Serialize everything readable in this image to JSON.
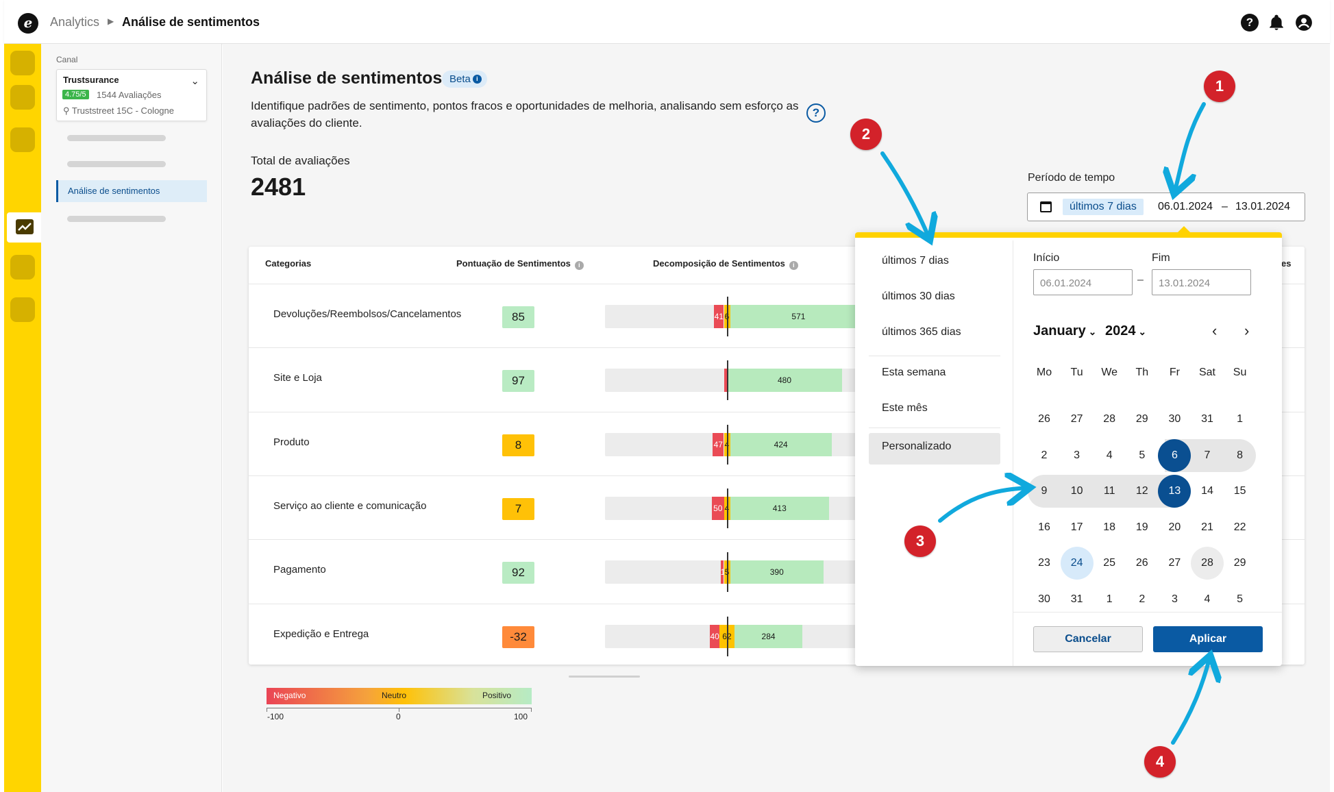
{
  "topbar": {
    "logo_glyph": "e",
    "breadcrumb_root": "Analytics",
    "breadcrumb_current": "Análise de sentimentos",
    "help_glyph": "?",
    "bell_glyph": "🔔",
    "user_glyph": "●"
  },
  "sidebar": {
    "channel_label": "Canal",
    "channel_name": "Trustsurance",
    "rating": "4.75/5",
    "reviews": "1544 Avaliações",
    "address": "Truststreet 15C - Cologne",
    "active_item": "Análise de sentimentos"
  },
  "page": {
    "title": "Análise de sentimentos",
    "beta_label": "Beta",
    "description": "Identifique padrões de sentimento, pontos fracos e oportunidades de melhoria, analisando sem esforço as avaliações do cliente.",
    "total_label": "Total de avaliações",
    "total_value": "2481"
  },
  "period": {
    "label": "Período de tempo",
    "chip": "últimos 7 dias",
    "start": "06.01.2024",
    "dash": "–",
    "end": "13.01.2024"
  },
  "table": {
    "headers": {
      "category": "Categorias",
      "score": "Pontuação de Sentimentos",
      "breakdown": "Decomposição de Sentimentos",
      "clipped_header": "es"
    },
    "rows": [
      {
        "category": "Devoluções/Reembolsos/Cancelamentos",
        "score": "85",
        "score_level": "green",
        "negative": "41",
        "neutral": "6",
        "positive": "571",
        "neg_count": 41,
        "neu_count": 6,
        "pos_count": 571
      },
      {
        "category": "Site e Loja",
        "score": "97",
        "score_level": "green",
        "negative": "",
        "neutral": "",
        "positive": "480",
        "neg_count": 2,
        "neu_count": 0,
        "pos_count": 480
      },
      {
        "category": "Produto",
        "score": "8",
        "score_level": "amber",
        "negative": "47",
        "neutral": "4",
        "positive": "424",
        "neg_count": 47,
        "neu_count": 4,
        "pos_count": 424
      },
      {
        "category": "Serviço ao cliente e comunicação",
        "score": "7",
        "score_level": "amber",
        "negative": "50",
        "neutral": "4",
        "positive": "413",
        "neg_count": 50,
        "neu_count": 4,
        "pos_count": 413
      },
      {
        "category": "Pagamento",
        "score": "92",
        "score_level": "green",
        "negative": "14",
        "neutral": "5",
        "positive": "390",
        "neg_count": 14,
        "neu_count": 5,
        "pos_count": 390
      },
      {
        "category": "Expedição e Entrega",
        "score": "-32",
        "score_level": "orange",
        "negative": "40",
        "neutral": "62",
        "positive": "284",
        "neg_count": 40,
        "neu_count": 62,
        "pos_count": 284
      }
    ]
  },
  "legend": {
    "negative": "Negativo",
    "neutral": "Neutro",
    "positive": "Positivo",
    "min": "-100",
    "mid": "0",
    "max": "100"
  },
  "datepicker": {
    "presets": [
      "últimos 7 dias",
      "últimos 30 dias",
      "últimos 365 dias",
      "Esta semana",
      "Este mês",
      "Personalizado"
    ],
    "active_preset": "Personalizado",
    "start_label": "Início",
    "end_label": "Fim",
    "start_placeholder": "06.01.2024",
    "end_placeholder": "13.01.2024",
    "field_dash": "–",
    "month": "January",
    "year": "2024",
    "prev_glyph": "‹",
    "next_glyph": "›",
    "weekdays": [
      "Mo",
      "Tu",
      "We",
      "Th",
      "Fr",
      "Sat",
      "Su"
    ],
    "weeks": [
      [
        "26",
        "27",
        "28",
        "29",
        "30",
        "31",
        "1"
      ],
      [
        "2",
        "3",
        "4",
        "5",
        "6",
        "7",
        "8"
      ],
      [
        "9",
        "10",
        "11",
        "12",
        "13",
        "14",
        "15"
      ],
      [
        "16",
        "17",
        "18",
        "19",
        "20",
        "21",
        "22"
      ],
      [
        "23",
        "24",
        "25",
        "26",
        "27",
        "28",
        "29"
      ],
      [
        "30",
        "31",
        "1",
        "2",
        "3",
        "4",
        "5"
      ]
    ],
    "selected_start": "6",
    "selected_end": "13",
    "today": "24",
    "hovered": "28",
    "cancel_label": "Cancelar",
    "apply_label": "Aplicar"
  },
  "annotations": [
    "1",
    "2",
    "3",
    "4"
  ],
  "colors": {
    "rail": "#ffd500",
    "primary": "#0a5aa3",
    "negative": "#ea4b55",
    "neutral": "#ffc300",
    "positive": "#b7eabd",
    "annotation": "#d3222a",
    "annotation_arrow": "#11a9dd"
  }
}
